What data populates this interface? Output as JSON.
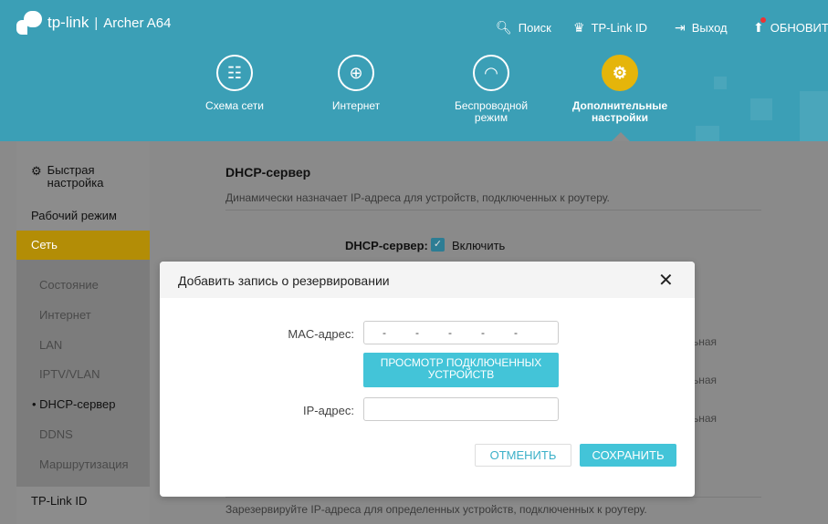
{
  "header": {
    "brand": "tp-link",
    "separator": "|",
    "model": "Archer A64",
    "links": [
      {
        "icon": "search-icon",
        "label": "Поиск"
      },
      {
        "icon": "account-icon",
        "label": "TP-Link ID"
      },
      {
        "icon": "logout-icon",
        "label": "Выход"
      },
      {
        "icon": "update-icon",
        "label": "ОБНОВИТ"
      }
    ]
  },
  "nav": [
    {
      "icon": "network-map-icon",
      "label": "Схема сети",
      "active": false
    },
    {
      "icon": "globe-icon",
      "label": "Интернет",
      "active": false
    },
    {
      "icon": "wifi-icon",
      "label": "Беспроводной режим",
      "active": false
    },
    {
      "icon": "gear-icon",
      "label": "Дополнительные настройки",
      "active": true
    }
  ],
  "sidebar": {
    "quick_setup": "Быстрая настройка",
    "operation_mode": "Рабочий режим",
    "network": "Сеть",
    "sub": [
      "Состояние",
      "Интернет",
      "LAN",
      "IPTV/VLAN",
      "DHCP-сервер",
      "DDNS",
      "Маршрутизация"
    ],
    "current_sub": "DHCP-сервер",
    "tplink_id": "TP-Link ID"
  },
  "main": {
    "section_title": "DHCP-сервер",
    "section_desc": "Динамически назначает IP-адреса для устройств, подключенных к роутеру.",
    "dhcp_label": "DHCP-сервер:",
    "enable_label": "Включить",
    "frag": [
      "льная",
      "льная",
      "льная"
    ],
    "reserve_desc": "Зарезервируйте IP-адреса для определенных устройств, подключенных к роутеру."
  },
  "modal": {
    "title": "Добавить запись о резервировании",
    "mac_label": "MAC-адрес:",
    "mac_placeholder": [
      "-",
      "-",
      "-",
      "-",
      "-"
    ],
    "scan_button": "ПРОСМОТР ПОДКЛЮЧЕННЫХ УСТРОЙСТВ",
    "ip_label": "IP-адрес:",
    "ip_value": "",
    "cancel": "ОТМЕНИТЬ",
    "save": "СОХРАНИТЬ"
  },
  "colors": {
    "header_bg": "#3b9fb6",
    "accent_yellow": "#e5b50a",
    "button_cyan": "#43c4d8"
  }
}
